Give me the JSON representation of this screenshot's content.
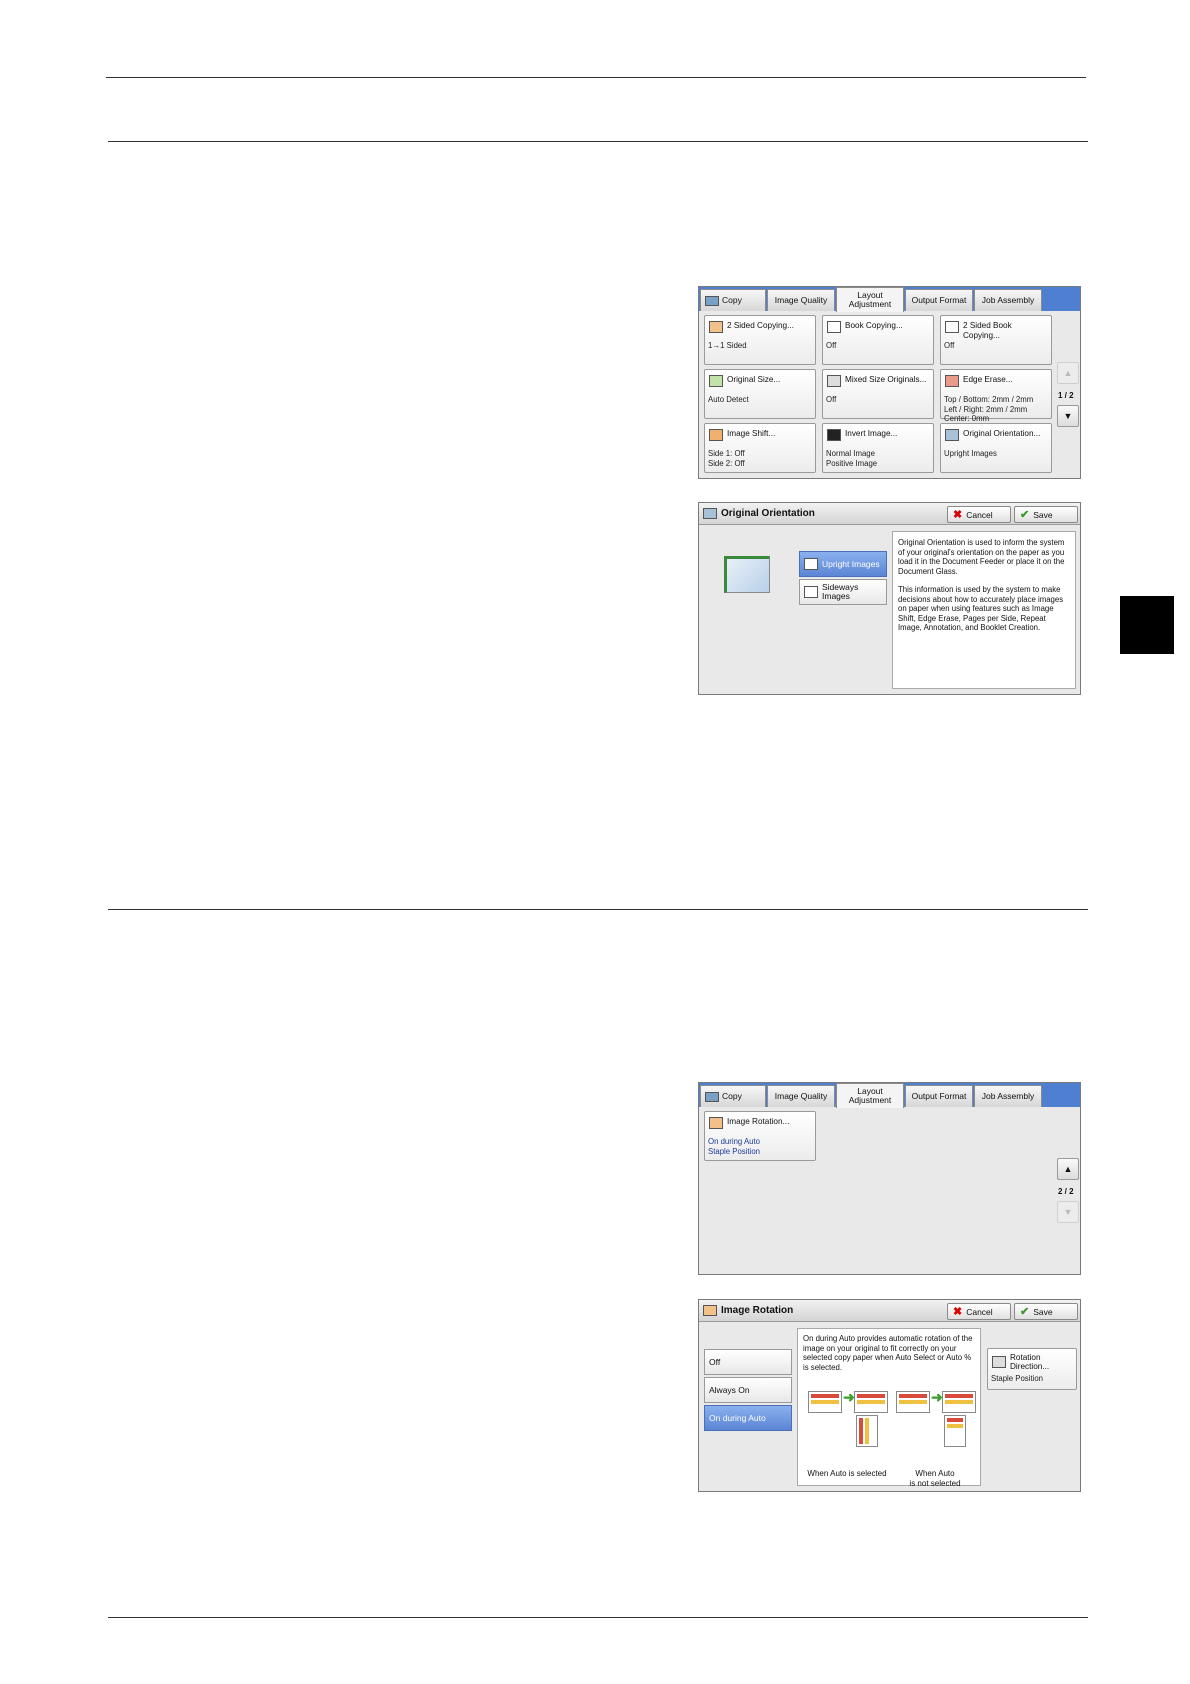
{
  "screen1": {
    "tabs": [
      "Copy",
      "Image Quality",
      "Layout Adjustment",
      "Output Format",
      "Job Assembly"
    ],
    "page": "1 / 2",
    "buttons": [
      {
        "title": "2 Sided Copying...",
        "value": "1→1 Sided"
      },
      {
        "title": "Book Copying...",
        "value": "Off"
      },
      {
        "title": "2 Sided Book Copying...",
        "value": "Off"
      },
      {
        "title": "Original Size...",
        "value": "Auto Detect"
      },
      {
        "title": "Mixed Size Originals...",
        "value": "Off"
      },
      {
        "title": "Edge Erase...",
        "value": "Top / Bottom: 2mm / 2mm\nLeft / Right: 2mm / 2mm\nCenter: 0mm"
      },
      {
        "title": "Image Shift...",
        "value": "Side 1: Off\nSide 2: Off"
      },
      {
        "title": "Invert Image...",
        "value": "Normal Image\nPositive Image"
      },
      {
        "title": "Original Orientation...",
        "value": "Upright Images"
      }
    ]
  },
  "screen2": {
    "title": "Original Orientation",
    "cancel": "Cancel",
    "save": "Save",
    "options": [
      "Upright Images",
      "Sideways Images"
    ],
    "description_1": "Original Orientation is used to inform the system of your original's orientation on the paper as you load it in the Document Feeder or place it on the Document Glass.",
    "description_2": "This information is used by the system to make decisions about how to accurately place images on paper when using features such as Image Shift, Edge Erase, Pages per Side, Repeat Image, Annotation, and Booklet Creation."
  },
  "screen3": {
    "tabs": [
      "Copy",
      "Image Quality",
      "Layout Adjustment",
      "Output Format",
      "Job Assembly"
    ],
    "page": "2 / 2",
    "button": {
      "title": "Image Rotation...",
      "value": "On during Auto\nStaple Position"
    }
  },
  "screen4": {
    "title": "Image Rotation",
    "cancel": "Cancel",
    "save": "Save",
    "options": [
      "Off",
      "Always On",
      "On during Auto"
    ],
    "description": "On during Auto provides automatic rotation of the image on your original to fit correctly on your selected copy paper when Auto Select or Auto % is selected.",
    "caption_1": "When Auto is selected",
    "caption_2": "When Auto\nis not selected",
    "rotation_button": {
      "title": "Rotation Direction...",
      "value": "Staple Position"
    }
  }
}
